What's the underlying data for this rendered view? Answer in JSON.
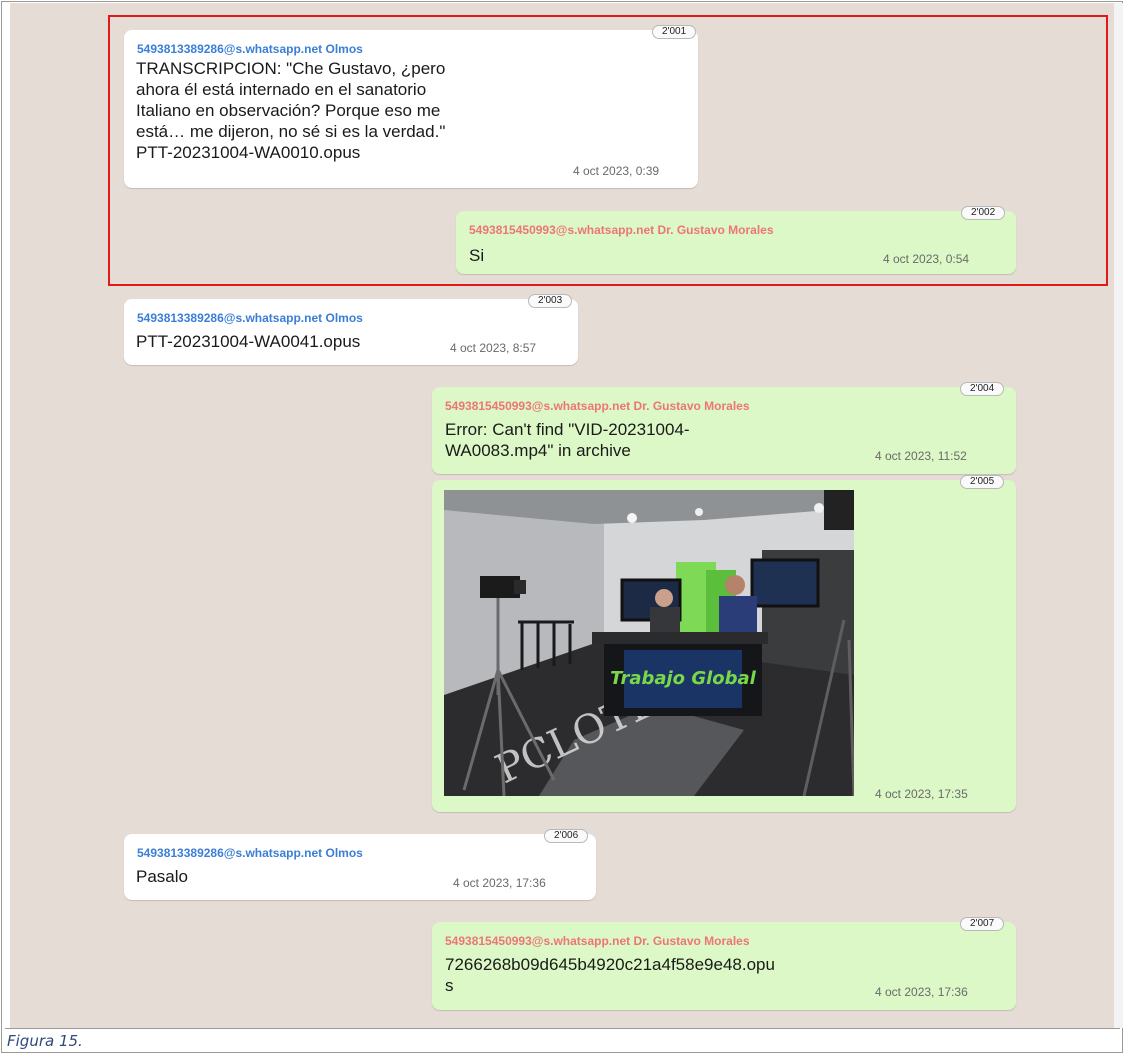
{
  "caption": "Figura 15.",
  "messages": [
    {
      "id": "2'001",
      "direction": "incoming",
      "sender": "5493813389286@s.whatsapp.net Olmos",
      "lines": [
        "TRANSCRIPCION: \"Che Gustavo, ¿pero",
        "ahora él está internado en el sanatorio",
        "Italiano en observación? Porque eso me",
        "está… me dijeron, no sé si es la verdad.\"",
        "PTT-20231004-WA0010.opus"
      ],
      "time": "4 oct 2023, 0:39"
    },
    {
      "id": "2'002",
      "direction": "outgoing",
      "sender": "5493815450993@s.whatsapp.net Dr. Gustavo Morales",
      "lines": [
        "Si"
      ],
      "time": "4 oct 2023, 0:54"
    },
    {
      "id": "2'003",
      "direction": "incoming",
      "sender": "5493813389286@s.whatsapp.net Olmos",
      "lines": [
        "PTT-20231004-WA0041.opus"
      ],
      "time": "4 oct 2023, 8:57"
    },
    {
      "id": "2'004",
      "direction": "outgoing",
      "sender": "5493815450993@s.whatsapp.net Dr. Gustavo Morales",
      "lines": [
        "Error: Can't find \"VID-20231004-",
        "WA0083.mp4\" in archive"
      ],
      "time": "4 oct 2023, 11:52"
    },
    {
      "id": "2'005",
      "direction": "outgoing",
      "image_sign_text": "Trabajo Global",
      "floor_text": "PCLOTE",
      "time": "4 oct 2023, 17:35"
    },
    {
      "id": "2'006",
      "direction": "incoming",
      "sender": "5493813389286@s.whatsapp.net Olmos",
      "lines": [
        "Pasalo"
      ],
      "time": "4 oct 2023, 17:36"
    },
    {
      "id": "2'007",
      "direction": "outgoing",
      "sender": "5493815450993@s.whatsapp.net Dr. Gustavo Morales",
      "lines": [
        "7266268b09d645b4920c21a4f58e9e48.opu",
        "s"
      ],
      "time": "4 oct 2023, 17:36"
    }
  ],
  "colors": {
    "chat_background": "#e5ddd5",
    "incoming_bubble": "#ffffff",
    "outgoing_bubble": "#dcf8c6",
    "incoming_sender": "#3a7ed8",
    "outgoing_sender": "#ee7575",
    "highlight_border": "#e01a1a"
  }
}
